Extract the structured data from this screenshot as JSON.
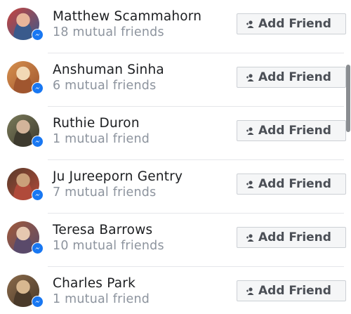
{
  "people": [
    {
      "name": "Matthew Scammahorn",
      "mutual": "18 mutual friends",
      "button_label": "Add Friend",
      "avatar_colors": [
        "#c9433d",
        "#e8b59a",
        "#3a5a8c"
      ]
    },
    {
      "name": "Anshuman Sinha",
      "mutual": "6 mutual friends",
      "button_label": "Add Friend",
      "avatar_colors": [
        "#d6904e",
        "#f2d9b5",
        "#a0562f"
      ]
    },
    {
      "name": "Ruthie Duron",
      "mutual": "1 mutual friend",
      "button_label": "Add Friend",
      "avatar_colors": [
        "#7a7b5a",
        "#d2b49a",
        "#3d3a2e"
      ]
    },
    {
      "name": "Ju Jureeporn Gentry",
      "mutual": "7 mutual friends",
      "button_label": "Add Friend",
      "avatar_colors": [
        "#5a3b2a",
        "#caa07a",
        "#b04a3a"
      ]
    },
    {
      "name": "Teresa Barrows",
      "mutual": "10 mutual friends",
      "button_label": "Add Friend",
      "avatar_colors": [
        "#a05a3a",
        "#e6c8b0",
        "#5a4a6a"
      ]
    },
    {
      "name": "Charles Park",
      "mutual": "1 mutual friend",
      "button_label": "Add Friend",
      "avatar_colors": [
        "#8a6a4a",
        "#d8b890",
        "#4a3a2a"
      ]
    }
  ],
  "icons": {
    "avatar_badge": "messenger-badge-icon",
    "button_icon": "add-person-icon"
  },
  "colors": {
    "badge_blue": "#1877f2",
    "name_text": "#1c1e21",
    "secondary_text": "#8d949e",
    "button_bg": "#f5f6f7",
    "button_border": "#ccd0d5",
    "button_text": "#4b4f56"
  }
}
